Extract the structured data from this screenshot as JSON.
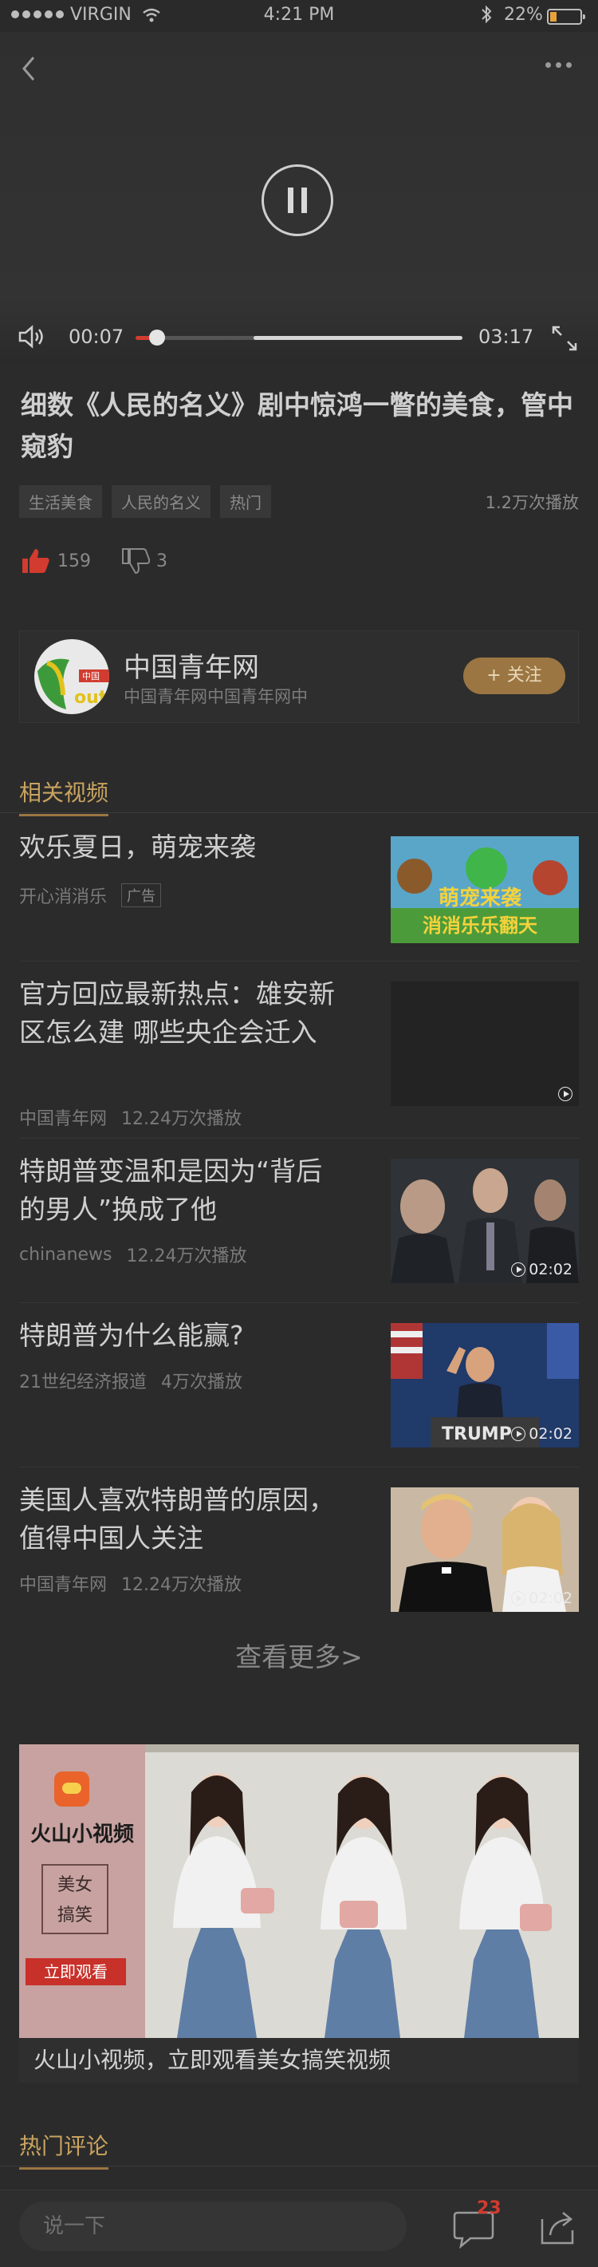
{
  "status_bar": {
    "carrier": "VIRGIN",
    "time": "4:21 PM",
    "battery": "22%",
    "battery_level": 0.22
  },
  "player": {
    "current_time": "00:07",
    "duration": "03:17",
    "played_fraction": 0.065,
    "buffer_start_fraction": 0.36
  },
  "video": {
    "title": "细数《人民的名义》剧中惊鸿一瞥的美食，管中窥豹",
    "tags": [
      "生活美食",
      "人民的名义",
      "热门"
    ],
    "views": "1.2万次播放",
    "likes": "159",
    "dislikes": "3"
  },
  "publisher": {
    "name": "中国青年网",
    "description": "中国青年网中国青年网中",
    "follow_label": "+ 关注"
  },
  "related": {
    "header": "相关视频",
    "items": [
      {
        "title": "欢乐夏日，萌宠来袭",
        "source": "开心消消乐",
        "meta": "",
        "badge": "广告",
        "duration": ""
      },
      {
        "title": "官方回应最新热点：雄安新区怎么建 哪些央企会迁入",
        "source": "中国青年网",
        "meta": "12.24万次播放",
        "badge": "",
        "duration": ""
      },
      {
        "title": "特朗普变温和是因为“背后的男人”换成了他",
        "source": "chinanews",
        "meta": "12.24万次播放",
        "badge": "",
        "duration": "02:02"
      },
      {
        "title": "特朗普为什么能赢?",
        "source": "21世纪经济报道",
        "meta": "4万次播放",
        "badge": "",
        "duration": "02:02"
      },
      {
        "title": "美国人喜欢特朗普的原因，值得中国人关注",
        "source": "中国青年网",
        "meta": "12.24万次播放",
        "badge": "",
        "duration": "02:02"
      }
    ],
    "see_more": "查看更多>"
  },
  "banner_ad": {
    "app_name": "火山小视频",
    "tag_text": "美女\n搞笑",
    "cta": "立即观看",
    "caption": "火山小视频，立即观看美女搞笑视频"
  },
  "thumb_texts": {
    "game_title_top": "萌宠来袭",
    "game_title_bottom": "消消乐乐翻天",
    "podium_sign": "TRUMP",
    "logo_text": "out"
  },
  "comments": {
    "header": "热门评论",
    "placeholder": "说一下",
    "count": "23"
  },
  "colors": {
    "accent_gold": "#9b7642",
    "accent_red": "#d23b2f",
    "background": "#2b2b2b"
  }
}
